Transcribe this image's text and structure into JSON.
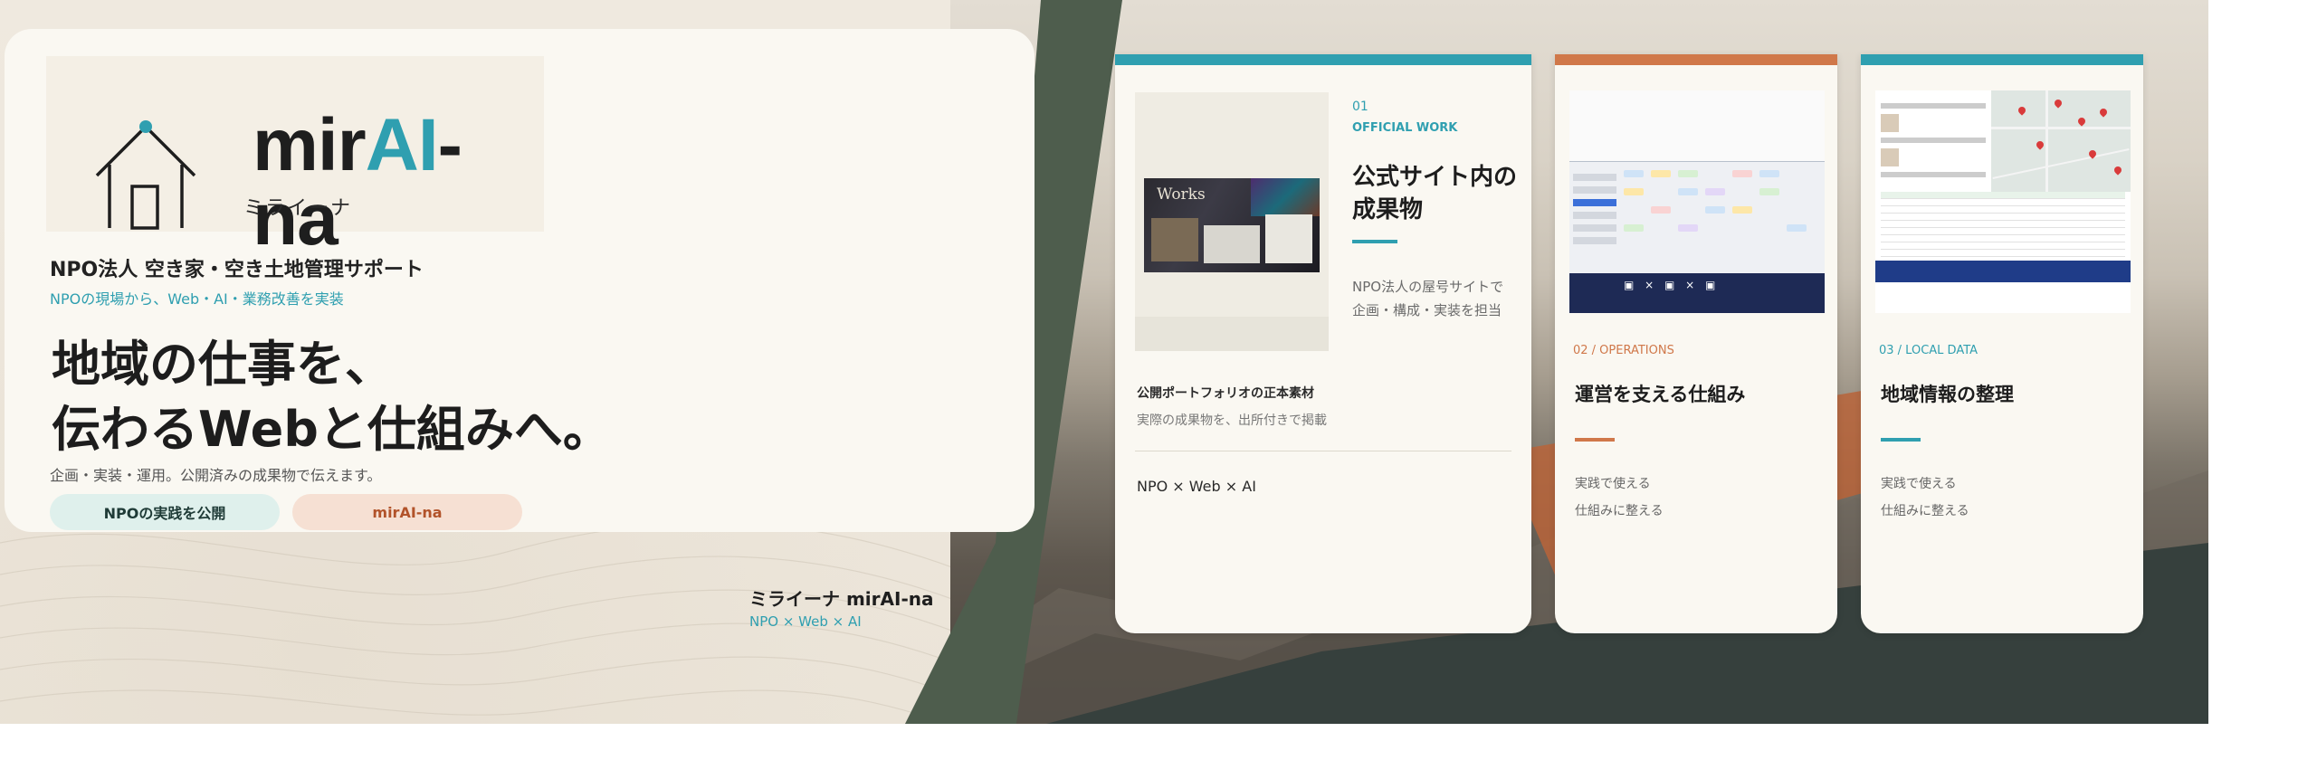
{
  "colors": {
    "teal": "#2f9fb0",
    "orange": "#d0784a",
    "ink": "#1d1d1d",
    "cream": "#faf8f2"
  },
  "hero": {
    "logo": {
      "word_pre": "mir",
      "word_ai": "AI",
      "word_post": "-na",
      "kana": "ミライーナ"
    },
    "org": "NPO法人 空き家・空き土地管理サポート",
    "tagline": "NPOの現場から、Web・AI・業務改善を実装",
    "headline_lines": [
      "地域の仕事を、",
      "伝わるWebと仕組みへ。"
    ],
    "sub": "企画・実装・運用。公開済みの成果物で伝えます。",
    "buttons": {
      "npo": "NPOの実践を公開",
      "mirai": "mirAI-na"
    }
  },
  "brand": {
    "name": "ミライーナ mirAI-na",
    "sub": "NPO × Web × AI"
  },
  "cards": [
    {
      "number": "01",
      "kicker": "OFFICIAL WORK",
      "title_lines": [
        "公式サイト内の",
        "成果物"
      ],
      "desc_lines": [
        "NPO法人の屋号サイトで",
        "企画・構成・実装を担当"
      ],
      "thumb_label": "Works",
      "caption": "公開ポートフォリオの正本素材",
      "caption_sub": "実際の成果物を、出所付きで掲載",
      "footer": "NPO × Web × AI",
      "accent": "#2f9fb0"
    },
    {
      "kicker": "02 / OPERATIONS",
      "title": "運営を支える仕組み",
      "lines": [
        "実践で使える",
        "仕組みに整える"
      ],
      "accent": "#d0784a"
    },
    {
      "kicker": "03 / LOCAL DATA",
      "title": "地域情報の整理",
      "lines": [
        "実践で使える",
        "仕組みに整える"
      ],
      "accent": "#2f9fb0"
    }
  ]
}
